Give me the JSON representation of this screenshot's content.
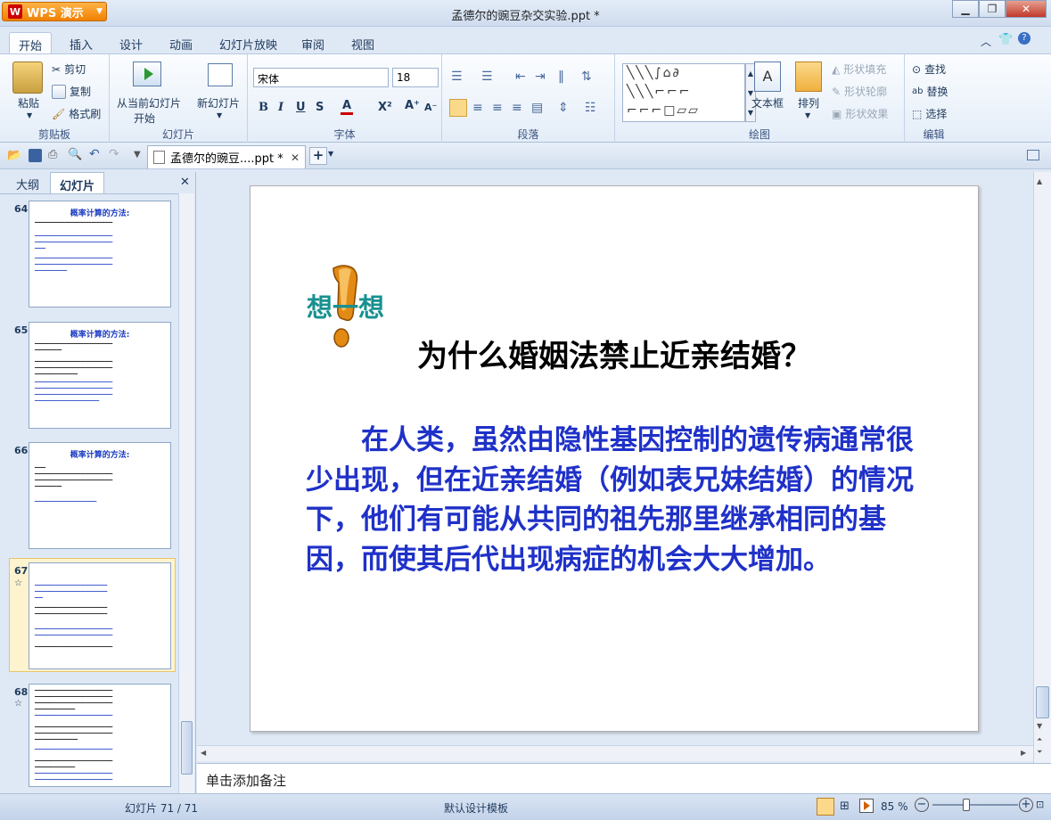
{
  "app": {
    "name": "WPS 演示",
    "window_title": "孟德尔的豌豆杂交实验.ppt *"
  },
  "menu_tabs": [
    "开始",
    "插入",
    "设计",
    "动画",
    "幻灯片放映",
    "审阅",
    "视图"
  ],
  "ribbon": {
    "clipboard": {
      "paste": "粘贴",
      "cut": "剪切",
      "copy": "复制",
      "format_painter": "格式刷",
      "group": "剪贴板"
    },
    "slides": {
      "from_current": "从当前幻灯片",
      "start": "开始",
      "new_slide": "新幻灯片",
      "group": "幻灯片"
    },
    "font": {
      "name": "宋体",
      "size": "18",
      "group": "字体"
    },
    "paragraph": {
      "group": "段落"
    },
    "drawing": {
      "textbox": "文本框",
      "arrange": "排列",
      "fill": "形状填充",
      "outline": "形状轮廓",
      "effect": "形状效果",
      "group": "绘图"
    },
    "edit": {
      "find": "查找",
      "replace": "替换",
      "select": "选择",
      "group": "编辑"
    }
  },
  "doc_tab": "孟德尔的豌豆....ppt *",
  "panel": {
    "tab_outline": "大纲",
    "tab_slides": "幻灯片"
  },
  "thumbnails": [
    {
      "num": "64",
      "title": "概率计算的方法:"
    },
    {
      "num": "65",
      "title": "概率计算的方法:"
    },
    {
      "num": "66",
      "title": "概率计算的方法:"
    },
    {
      "num": "67",
      "title": ""
    },
    {
      "num": "68",
      "title": ""
    }
  ],
  "slide": {
    "think": "想一想",
    "question": "为什么婚姻法禁止近亲结婚？",
    "body": "在人类，虽然由隐性基因控制的遗传病通常很少出现，但在近亲结婚（例如表兄妹结婚）的情况下，他们有可能从共同的祖先那里继承相同的基因，而使其后代出现病症的机会大大增加。"
  },
  "notes_placeholder": "单击添加备注",
  "status": {
    "slide_count": "幻灯片 71 / 71",
    "template": "默认设计模板",
    "zoom": "85 %"
  }
}
